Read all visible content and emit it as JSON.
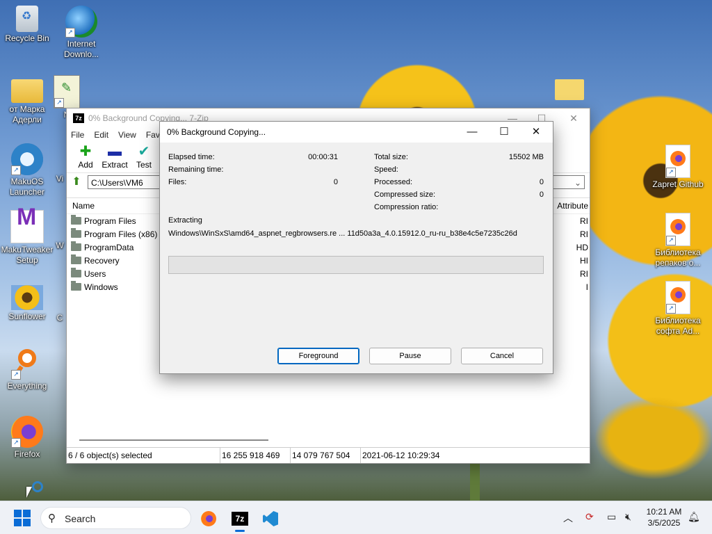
{
  "desktop": {
    "left_icons": [
      {
        "label": "Recycle Bin",
        "icon": "recycle-bin-icon"
      },
      {
        "label": "Internet Downlo...",
        "icon": "internet-download-manager-icon"
      },
      {
        "label": "от Марка Адерли",
        "icon": "folder-icon"
      },
      {
        "label": "N",
        "icon": "notepad-icon"
      },
      {
        "label": "MakuOS Launcher",
        "icon": "makuos-launcher-icon"
      },
      {
        "label": "Vi",
        "icon": "partial-icon"
      },
      {
        "label": "MakuTweaker Setup",
        "icon": "makutweaker-icon"
      },
      {
        "label": "W",
        "icon": "partial-icon"
      },
      {
        "label": "Sunflower",
        "icon": "sunflower-icon"
      },
      {
        "label": "C",
        "icon": "partial-icon"
      },
      {
        "label": "Everything",
        "icon": "everything-search-icon"
      },
      {
        "label": "Firefox",
        "icon": "firefox-icon"
      }
    ],
    "right_icons": [
      {
        "label": "Zapret Github",
        "icon": "firefox-icon"
      },
      {
        "label": "Библиотека репаков о...",
        "icon": "firefox-icon"
      },
      {
        "label": "Библиотека софта Ad...",
        "icon": "firefox-icon"
      }
    ]
  },
  "zip_window": {
    "title": "0% Background Copying... 7-Zip",
    "app_icon_text": "7z",
    "menu": [
      "File",
      "Edit",
      "View",
      "Favo"
    ],
    "toolbar": [
      {
        "label": "Add",
        "icon": "plus-icon",
        "glyph": "✚",
        "color": "#1aa31a"
      },
      {
        "label": "Extract",
        "icon": "minus-icon",
        "glyph": "▬",
        "color": "#1d2ea6"
      },
      {
        "label": "Test",
        "icon": "check-icon",
        "glyph": "✔",
        "color": "#1aa89a"
      }
    ],
    "address": "C:\\Users\\VM6",
    "columns": {
      "name": "Name",
      "attributes": "Attribute"
    },
    "files": [
      {
        "name": "Program Files",
        "attr": "RI"
      },
      {
        "name": "Program Files (x86)",
        "attr": "RI"
      },
      {
        "name": "ProgramData",
        "attr": "HD"
      },
      {
        "name": "Recovery",
        "attr": "HI"
      },
      {
        "name": "Users",
        "attr": "RI"
      },
      {
        "name": "Windows",
        "attr": "I"
      }
    ],
    "status": {
      "selected": "6 / 6 object(s) selected",
      "size": "16 255 918 469",
      "packed": "14 079 767 504",
      "modified": "2021-06-12 10:29:34"
    }
  },
  "progress_dialog": {
    "title": "0% Background Copying...",
    "left_stats": [
      {
        "label": "Elapsed time:",
        "value": "00:00:31"
      },
      {
        "label": "Remaining time:",
        "value": ""
      },
      {
        "label": "Files:",
        "value": "0"
      }
    ],
    "right_stats": [
      {
        "label": "Total size:",
        "value": "15502 MB"
      },
      {
        "label": "Speed:",
        "value": ""
      },
      {
        "label": "Processed:",
        "value": "0"
      },
      {
        "label": "Compressed size:",
        "value": "0"
      },
      {
        "label": "Compression ratio:",
        "value": ""
      }
    ],
    "operation": "Extracting",
    "current_file": "Windows\\WinSxS\\amd64_aspnet_regbrowsers.re ... 11d50a3a_4.0.15912.0_ru-ru_b38e4c5e7235c26d",
    "progress_fraction": 0.0,
    "buttons": {
      "foreground": "Foreground",
      "pause": "Pause",
      "cancel": "Cancel"
    }
  },
  "taskbar": {
    "search_placeholder": "Search",
    "apps": [
      "firefox-icon",
      "7zip-icon",
      "vscode-icon"
    ],
    "seven_zip_label": "7z",
    "clock": {
      "time": "10:21 AM",
      "date": "3/5/2025"
    }
  },
  "colors": {
    "accent": "#0067c0",
    "progress": "#06b025",
    "start": "#0a6cd6"
  }
}
